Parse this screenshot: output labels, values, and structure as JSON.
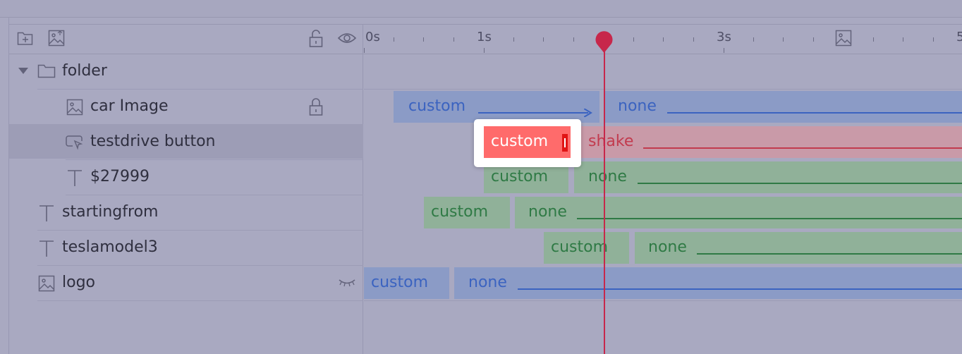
{
  "toolbar": {
    "add_folder_icon": "folder-plus-icon",
    "add_image_icon": "image-upload-icon",
    "lock_icon": "lock-icon",
    "visibility_icon": "eye-icon"
  },
  "layers": [
    {
      "name": "folder",
      "icon": "folder-icon",
      "expanded": true
    },
    {
      "name": "car Image",
      "icon": "image-icon",
      "locked": true
    },
    {
      "name": "testdrive button",
      "icon": "button-icon",
      "selected": true
    },
    {
      "name": "$27999",
      "icon": "text-icon"
    },
    {
      "name": "startingfrom",
      "icon": "text-icon"
    },
    {
      "name": "teslamodel3",
      "icon": "text-icon"
    },
    {
      "name": "logo",
      "icon": "image-icon",
      "hidden": true
    }
  ],
  "ruler": {
    "labels": [
      "0s",
      "1s",
      "3s",
      "5"
    ],
    "image_marker_icon": "image-marker-icon"
  },
  "timeline": {
    "car_image": {
      "in": "custom",
      "out": "none"
    },
    "testdrive_button": {
      "in": "custom",
      "out": "shake"
    },
    "price": {
      "in": "custom",
      "out": "none"
    },
    "startingfrom": {
      "in": "custom",
      "out": "none"
    },
    "teslamodel3": {
      "in": "custom",
      "out": "none"
    },
    "logo": {
      "in": "custom",
      "out": "none"
    }
  },
  "colors": {
    "blue": "#3b63c0",
    "green": "#2f7a45",
    "red": "#c23b4e",
    "playhead": "#c7274b",
    "selected_bar": "#ff6b6b"
  }
}
